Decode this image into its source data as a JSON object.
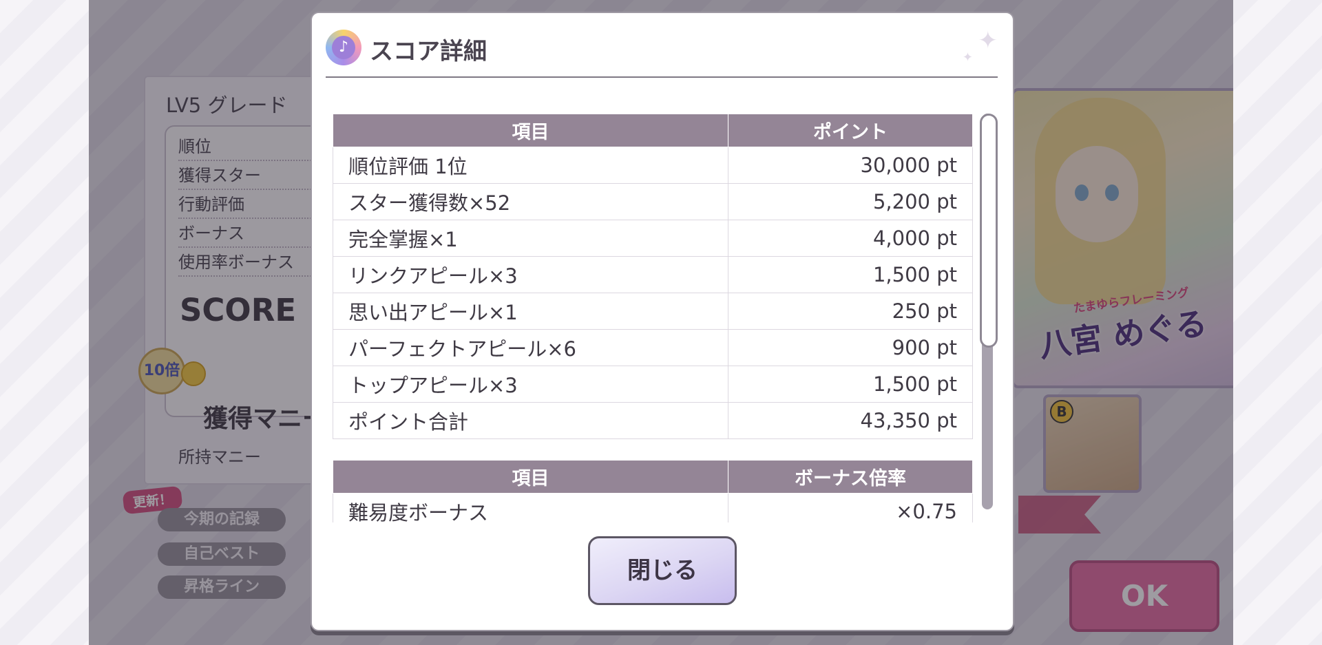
{
  "background": {
    "result_panel": {
      "title": "LV5 グレード",
      "rows": [
        "順位",
        "獲得スター",
        "行動評価",
        "ボーナス",
        "使用率ボーナス"
      ],
      "score_label": "SCORE",
      "money_title": "獲得マニー",
      "money_badge": "10倍",
      "owned_money": "所持マニー"
    },
    "updated_tag": "更新！",
    "buttons": [
      "今期の記録",
      "自己ベスト",
      "昇格ライン"
    ],
    "card": {
      "subtitle": "たまゆらフレーミング",
      "name": "八宮 めぐる",
      "badge": "B"
    },
    "ok_label": "OK"
  },
  "modal": {
    "title": "スコア詳細",
    "points_table": {
      "headers": [
        "項目",
        "ポイント"
      ],
      "rows": [
        {
          "item": "順位評価 1位",
          "value": "30,000 pt"
        },
        {
          "item": "スター獲得数×52",
          "value": "5,200 pt"
        },
        {
          "item": "完全掌握×1",
          "value": "4,000 pt"
        },
        {
          "item": "リンクアピール×3",
          "value": "1,500 pt"
        },
        {
          "item": "思い出アピール×1",
          "value": "250 pt"
        },
        {
          "item": "パーフェクトアピール×6",
          "value": "900 pt"
        },
        {
          "item": "トップアピール×3",
          "value": "1,500 pt"
        },
        {
          "item": "ポイント合計",
          "value": "43,350 pt"
        }
      ]
    },
    "bonus_table": {
      "headers": [
        "項目",
        "ボーナス倍率"
      ],
      "rows": [
        {
          "item": "難易度ボーナス",
          "value": "×0.75"
        }
      ]
    },
    "close_label": "閉じる"
  }
}
